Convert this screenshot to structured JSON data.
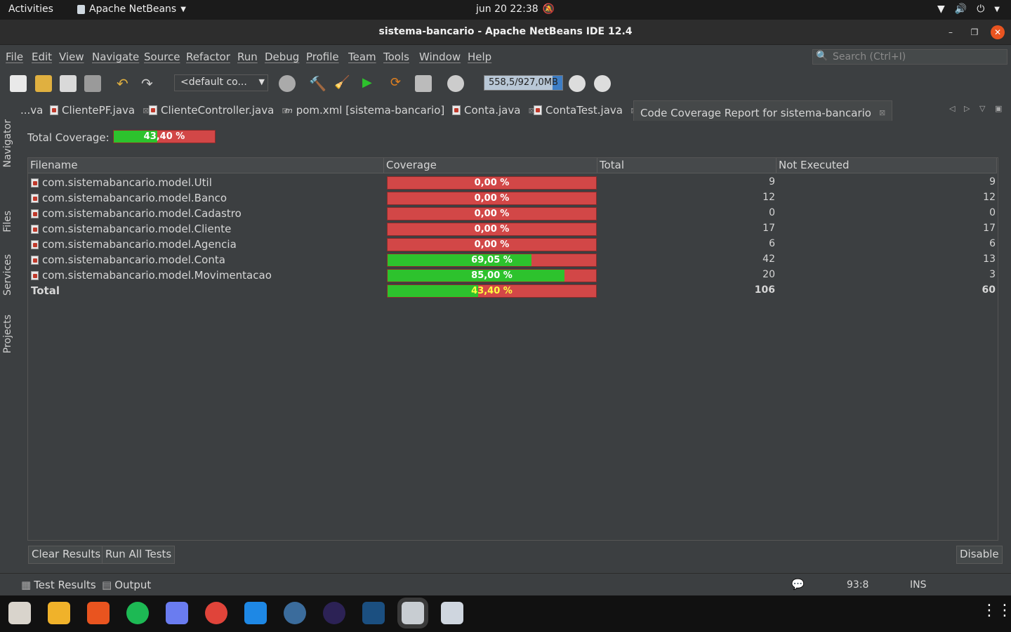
{
  "system_bar": {
    "activities": "Activities",
    "app": "Apache NetBeans",
    "clock": "jun 20  22:38"
  },
  "window": {
    "title": "sistema-bancario - Apache NetBeans IDE 12.4"
  },
  "menu": [
    "File",
    "Edit",
    "View",
    "Navigate",
    "Source",
    "Refactor",
    "Run",
    "Debug",
    "Profile",
    "Team",
    "Tools",
    "Window",
    "Help"
  ],
  "search": {
    "placeholder": "Search (Ctrl+I)"
  },
  "toolbar": {
    "config": "<default co...",
    "memory": "558,5/927,0MB"
  },
  "side_tabs": [
    "Navigator",
    "Files",
    "Services",
    "Projects"
  ],
  "tabs": [
    "...va",
    "ClientePF.java",
    "ClienteController.java",
    "pom.xml [sistema-bancario]",
    "Conta.java",
    "ContaTest.java",
    "Code Coverage Report for sistema-bancario"
  ],
  "report": {
    "total_label": "Total Coverage:",
    "total_value": "43,40 %",
    "total_pct": 43.4,
    "columns": [
      "Filename",
      "Coverage",
      "Total",
      "Not Executed"
    ],
    "rows": [
      {
        "name": "com.sistemabancario.model.Util",
        "coverage": "0,00 %",
        "pct": 0,
        "total": "9",
        "not_executed": "9"
      },
      {
        "name": "com.sistemabancario.model.Banco",
        "coverage": "0,00 %",
        "pct": 0,
        "total": "12",
        "not_executed": "12"
      },
      {
        "name": "com.sistemabancario.model.Cadastro",
        "coverage": "0,00 %",
        "pct": 0,
        "total": "0",
        "not_executed": "0"
      },
      {
        "name": "com.sistemabancario.model.Cliente",
        "coverage": "0,00 %",
        "pct": 0,
        "total": "17",
        "not_executed": "17"
      },
      {
        "name": "com.sistemabancario.model.Agencia",
        "coverage": "0,00 %",
        "pct": 0,
        "total": "6",
        "not_executed": "6"
      },
      {
        "name": "com.sistemabancario.model.Conta",
        "coverage": "69,05 %",
        "pct": 69.05,
        "total": "42",
        "not_executed": "13"
      },
      {
        "name": "com.sistemabancario.model.Movimentacao",
        "coverage": "85,00 %",
        "pct": 85,
        "total": "20",
        "not_executed": "3"
      }
    ],
    "total_row": {
      "name": "Total",
      "coverage": "43,40 %",
      "pct": 43.4,
      "total": "106",
      "not_executed": "60"
    },
    "buttons": {
      "clear": "Clear Results",
      "run_all": "Run All Tests",
      "disable": "Disable"
    }
  },
  "status": {
    "test_results": "Test Results",
    "output": "Output",
    "position": "93:8",
    "mode": "INS"
  },
  "colors": {
    "covered": "#2dc22d",
    "uncovered": "#d24747",
    "close": "#e95420"
  }
}
